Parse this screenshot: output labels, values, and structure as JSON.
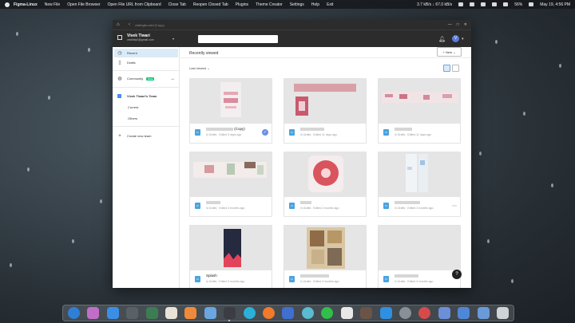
{
  "menubar": {
    "items": [
      "Figma-Linux",
      "New File",
      "Open File Browser",
      "Open File URL from Clipboard",
      "Close Tab",
      "Reopen Closed Tab",
      "Plugins",
      "Theme Creator",
      "Settings",
      "Help",
      "Exit"
    ],
    "network": "3.7 kB/s ↓ 67.0 kB/s",
    "battery": "56%",
    "datetime": "May 19, 4:56 PM"
  },
  "window": {
    "tab_title": "clabbgfs.oaid (Copy)"
  },
  "user": {
    "name": "Vivek Tiwari",
    "email": "vivektiw2@gmail.com"
  },
  "sidebar": {
    "recent": "Recent",
    "drafts": "Drafts",
    "community": "Community",
    "community_badge": "Beta",
    "team": "Vivek Tiwari's Team",
    "current": "Current",
    "others": "Others",
    "create_team": "Create new team"
  },
  "main": {
    "title": "Recently viewed",
    "new_button": "+ New ⌄",
    "sort_label": "Last viewed ⌄"
  },
  "files": [
    {
      "name": "(Copy)",
      "meta": "In Drafts · Edited 3 days ago",
      "thumb": "a"
    },
    {
      "name": "",
      "meta": "In Drafts · Edited 11 days ago",
      "thumb": "b"
    },
    {
      "name": "",
      "meta": "In Drafts · Edited 11 days ago",
      "thumb": "c"
    },
    {
      "name": "",
      "meta": "In Drafts · Edited 3 months ago",
      "thumb": "d"
    },
    {
      "name": "",
      "meta": "In Drafts · Edited 2 months ago",
      "thumb": "e"
    },
    {
      "name": "",
      "meta": "In Drafts · Edited 3 months ago",
      "thumb": "f"
    },
    {
      "name": "Splash",
      "meta": "In Drafts · Edited 3 months ago",
      "thumb": "g"
    },
    {
      "name": "",
      "meta": "In Drafts · Edited 3 months ago",
      "thumb": "h"
    },
    {
      "name": "",
      "meta": "In Drafts · Edited 3 months ago",
      "thumb": "i"
    }
  ],
  "help": "?"
}
